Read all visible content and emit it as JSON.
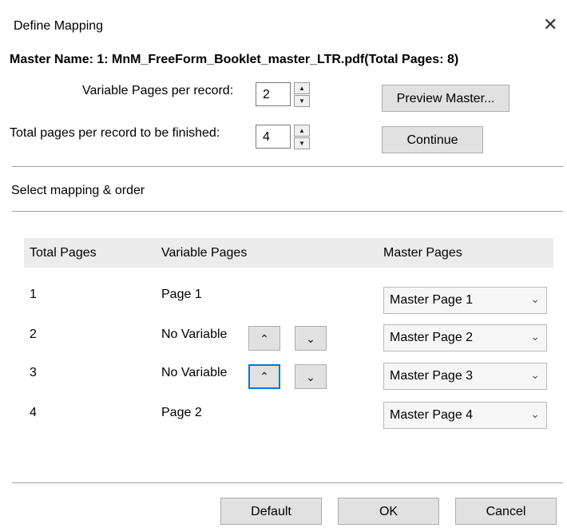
{
  "dialog": {
    "title": "Define Mapping",
    "close_glyph": "✕",
    "master_name": "Master Name: 1: MnM_FreeForm_Booklet_master_LTR.pdf(Total Pages: 8)"
  },
  "settings": {
    "variable_pages_label": "Variable Pages per record:",
    "variable_pages_value": "2",
    "total_pages_label": "Total pages per record to be finished:",
    "total_pages_value": "4",
    "preview_button": "Preview Master...",
    "continue_button": "Continue"
  },
  "section_label": "Select mapping & order",
  "table": {
    "headers": [
      "Total Pages",
      "Variable Pages",
      "Master Pages"
    ],
    "rows": [
      {
        "total": "1",
        "variable": "Page 1",
        "master": "Master Page 1"
      },
      {
        "total": "2",
        "variable": "No Variable",
        "master": "Master Page 2"
      },
      {
        "total": "3",
        "variable": "No Variable",
        "master": "Master Page 3"
      },
      {
        "total": "4",
        "variable": "Page 2",
        "master": "Master Page 4"
      }
    ]
  },
  "footer": {
    "default_button": "Default",
    "ok_button": "OK",
    "cancel_button": "Cancel"
  },
  "icons": {
    "spin_up": "▲",
    "spin_down": "▼",
    "move_up": "⌃",
    "move_down": "⌄",
    "dropdown": "⌄"
  },
  "colors": {
    "focus_border": "#0078d7",
    "button_bg": "#e1e1e1",
    "header_bg": "#ececec"
  }
}
